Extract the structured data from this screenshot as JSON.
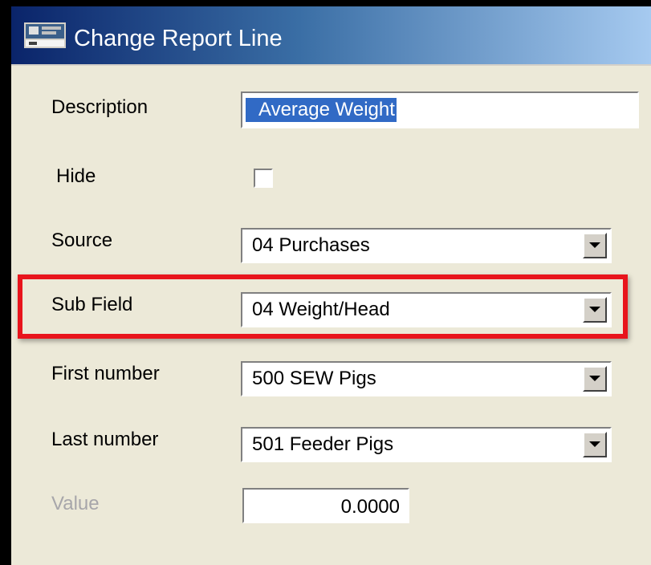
{
  "window": {
    "title": "Change Report Line",
    "icon": "app-window-icon"
  },
  "form": {
    "description": {
      "label": "Description",
      "value": "Average Weight"
    },
    "hide": {
      "label": "Hide",
      "checked": false
    },
    "source": {
      "label": "Source",
      "value": "04  Purchases"
    },
    "sub_field": {
      "label": "Sub Field",
      "value": "04  Weight/Head",
      "highlighted": true
    },
    "first_number": {
      "label": "First number",
      "value": "500  SEW Pigs"
    },
    "last_number": {
      "label": "Last number",
      "value": "501  Feeder Pigs"
    },
    "value": {
      "label": "Value",
      "value": "0.0000",
      "disabled": true
    }
  },
  "colors": {
    "highlight": "#e8141c",
    "selection": "#316ac5",
    "dialog_bg": "#ece9d8"
  }
}
